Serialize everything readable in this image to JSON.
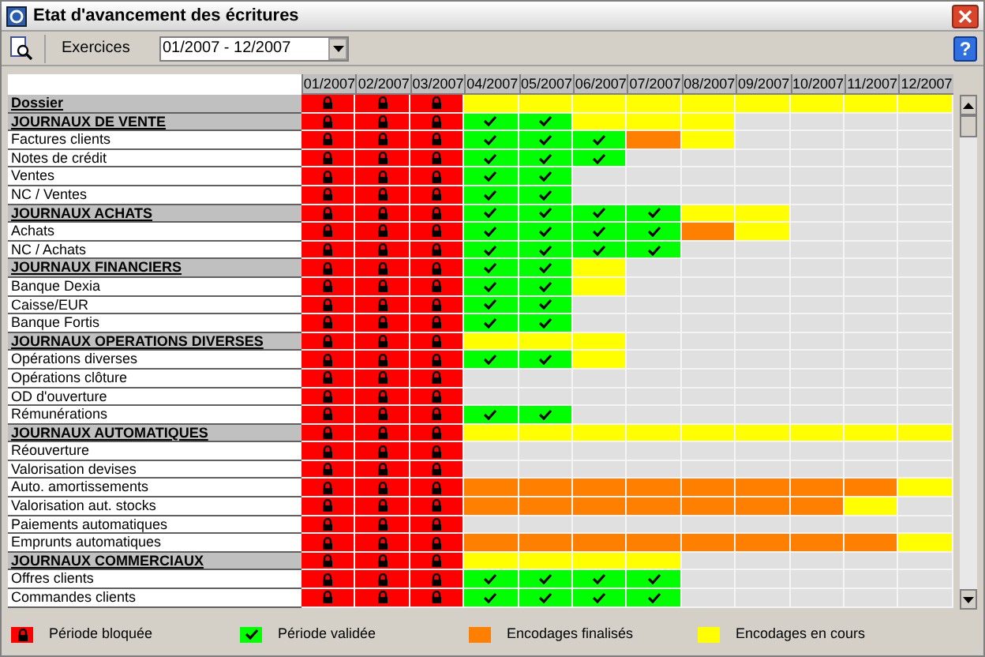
{
  "window": {
    "title": "Etat d'avancement des écritures",
    "help": "?"
  },
  "toolbar": {
    "label": "Exercices",
    "period": "01/2007 - 12/2007"
  },
  "months": [
    "01/2007",
    "02/2007",
    "03/2007",
    "04/2007",
    "05/2007",
    "06/2007",
    "07/2007",
    "08/2007",
    "09/2007",
    "10/2007",
    "11/2007",
    "12/2007"
  ],
  "rows": [
    {
      "label": "Dossier",
      "kind": "group",
      "cells": [
        {
          "kind": "lock"
        },
        {
          "kind": "lock"
        },
        {
          "kind": "lock"
        },
        {
          "kind": "open"
        },
        {
          "kind": "open"
        },
        {
          "kind": "open"
        },
        {
          "kind": "open"
        },
        {
          "kind": "open"
        },
        {
          "kind": "open"
        },
        {
          "kind": "open"
        },
        {
          "kind": "open"
        },
        {
          "kind": "open"
        }
      ]
    },
    {
      "label": "JOURNAUX DE VENTE",
      "kind": "group",
      "cells": [
        {
          "kind": "lock"
        },
        {
          "kind": "lock"
        },
        {
          "kind": "lock"
        },
        {
          "kind": "ok"
        },
        {
          "kind": "ok"
        },
        {
          "kind": "open"
        },
        {
          "kind": "open"
        },
        {
          "kind": "open"
        },
        {
          "kind": "none"
        },
        {
          "kind": "none"
        },
        {
          "kind": "none"
        },
        {
          "kind": "none"
        }
      ]
    },
    {
      "label": "Factures clients",
      "kind": "item",
      "cells": [
        {
          "kind": "lock"
        },
        {
          "kind": "lock"
        },
        {
          "kind": "lock"
        },
        {
          "kind": "ok"
        },
        {
          "kind": "ok"
        },
        {
          "kind": "ok"
        },
        {
          "kind": "done"
        },
        {
          "kind": "open"
        },
        {
          "kind": "none"
        },
        {
          "kind": "none"
        },
        {
          "kind": "none"
        },
        {
          "kind": "none"
        }
      ]
    },
    {
      "label": "Notes de crédit",
      "kind": "item",
      "cells": [
        {
          "kind": "lock"
        },
        {
          "kind": "lock"
        },
        {
          "kind": "lock"
        },
        {
          "kind": "ok"
        },
        {
          "kind": "ok"
        },
        {
          "kind": "ok"
        },
        {
          "kind": "none"
        },
        {
          "kind": "none"
        },
        {
          "kind": "none"
        },
        {
          "kind": "none"
        },
        {
          "kind": "none"
        },
        {
          "kind": "none"
        }
      ]
    },
    {
      "label": "Ventes",
      "kind": "item",
      "cells": [
        {
          "kind": "lock"
        },
        {
          "kind": "lock"
        },
        {
          "kind": "lock"
        },
        {
          "kind": "ok"
        },
        {
          "kind": "ok"
        },
        {
          "kind": "none"
        },
        {
          "kind": "none"
        },
        {
          "kind": "none"
        },
        {
          "kind": "none"
        },
        {
          "kind": "none"
        },
        {
          "kind": "none"
        },
        {
          "kind": "none"
        }
      ]
    },
    {
      "label": "NC / Ventes",
      "kind": "item",
      "cells": [
        {
          "kind": "lock"
        },
        {
          "kind": "lock"
        },
        {
          "kind": "lock"
        },
        {
          "kind": "ok"
        },
        {
          "kind": "ok"
        },
        {
          "kind": "none"
        },
        {
          "kind": "none"
        },
        {
          "kind": "none"
        },
        {
          "kind": "none"
        },
        {
          "kind": "none"
        },
        {
          "kind": "none"
        },
        {
          "kind": "none"
        }
      ]
    },
    {
      "label": "JOURNAUX ACHATS",
      "kind": "group",
      "cells": [
        {
          "kind": "lock"
        },
        {
          "kind": "lock"
        },
        {
          "kind": "lock"
        },
        {
          "kind": "ok"
        },
        {
          "kind": "ok"
        },
        {
          "kind": "ok"
        },
        {
          "kind": "ok"
        },
        {
          "kind": "open"
        },
        {
          "kind": "open"
        },
        {
          "kind": "none"
        },
        {
          "kind": "none"
        },
        {
          "kind": "none"
        }
      ]
    },
    {
      "label": "Achats",
      "kind": "item",
      "cells": [
        {
          "kind": "lock"
        },
        {
          "kind": "lock"
        },
        {
          "kind": "lock"
        },
        {
          "kind": "ok"
        },
        {
          "kind": "ok"
        },
        {
          "kind": "ok"
        },
        {
          "kind": "ok"
        },
        {
          "kind": "done"
        },
        {
          "kind": "open"
        },
        {
          "kind": "none"
        },
        {
          "kind": "none"
        },
        {
          "kind": "none"
        }
      ]
    },
    {
      "label": "NC / Achats",
      "kind": "item",
      "cells": [
        {
          "kind": "lock"
        },
        {
          "kind": "lock"
        },
        {
          "kind": "lock"
        },
        {
          "kind": "ok"
        },
        {
          "kind": "ok"
        },
        {
          "kind": "ok"
        },
        {
          "kind": "ok"
        },
        {
          "kind": "none"
        },
        {
          "kind": "none"
        },
        {
          "kind": "none"
        },
        {
          "kind": "none"
        },
        {
          "kind": "none"
        }
      ]
    },
    {
      "label": "JOURNAUX FINANCIERS",
      "kind": "group",
      "cells": [
        {
          "kind": "lock"
        },
        {
          "kind": "lock"
        },
        {
          "kind": "lock"
        },
        {
          "kind": "ok"
        },
        {
          "kind": "ok"
        },
        {
          "kind": "open"
        },
        {
          "kind": "none"
        },
        {
          "kind": "none"
        },
        {
          "kind": "none"
        },
        {
          "kind": "none"
        },
        {
          "kind": "none"
        },
        {
          "kind": "none"
        }
      ]
    },
    {
      "label": "Banque Dexia",
      "kind": "item",
      "cells": [
        {
          "kind": "lock"
        },
        {
          "kind": "lock"
        },
        {
          "kind": "lock"
        },
        {
          "kind": "ok"
        },
        {
          "kind": "ok"
        },
        {
          "kind": "open"
        },
        {
          "kind": "none"
        },
        {
          "kind": "none"
        },
        {
          "kind": "none"
        },
        {
          "kind": "none"
        },
        {
          "kind": "none"
        },
        {
          "kind": "none"
        }
      ]
    },
    {
      "label": "Caisse/EUR",
      "kind": "item",
      "cells": [
        {
          "kind": "lock"
        },
        {
          "kind": "lock"
        },
        {
          "kind": "lock"
        },
        {
          "kind": "ok"
        },
        {
          "kind": "ok"
        },
        {
          "kind": "none"
        },
        {
          "kind": "none"
        },
        {
          "kind": "none"
        },
        {
          "kind": "none"
        },
        {
          "kind": "none"
        },
        {
          "kind": "none"
        },
        {
          "kind": "none"
        }
      ]
    },
    {
      "label": "Banque Fortis",
      "kind": "item",
      "cells": [
        {
          "kind": "lock"
        },
        {
          "kind": "lock"
        },
        {
          "kind": "lock"
        },
        {
          "kind": "ok"
        },
        {
          "kind": "ok"
        },
        {
          "kind": "none"
        },
        {
          "kind": "none"
        },
        {
          "kind": "none"
        },
        {
          "kind": "none"
        },
        {
          "kind": "none"
        },
        {
          "kind": "none"
        },
        {
          "kind": "none"
        }
      ]
    },
    {
      "label": "JOURNAUX OPERATIONS DIVERSES",
      "kind": "group",
      "cells": [
        {
          "kind": "lock"
        },
        {
          "kind": "lock"
        },
        {
          "kind": "lock"
        },
        {
          "kind": "open"
        },
        {
          "kind": "open"
        },
        {
          "kind": "open"
        },
        {
          "kind": "none"
        },
        {
          "kind": "none"
        },
        {
          "kind": "none"
        },
        {
          "kind": "none"
        },
        {
          "kind": "none"
        },
        {
          "kind": "none"
        }
      ]
    },
    {
      "label": "Opérations diverses",
      "kind": "item",
      "cells": [
        {
          "kind": "lock"
        },
        {
          "kind": "lock"
        },
        {
          "kind": "lock"
        },
        {
          "kind": "ok"
        },
        {
          "kind": "ok"
        },
        {
          "kind": "open"
        },
        {
          "kind": "none"
        },
        {
          "kind": "none"
        },
        {
          "kind": "none"
        },
        {
          "kind": "none"
        },
        {
          "kind": "none"
        },
        {
          "kind": "none"
        }
      ]
    },
    {
      "label": "Opérations clôture",
      "kind": "item",
      "cells": [
        {
          "kind": "lock"
        },
        {
          "kind": "lock"
        },
        {
          "kind": "lock"
        },
        {
          "kind": "none"
        },
        {
          "kind": "none"
        },
        {
          "kind": "none"
        },
        {
          "kind": "none"
        },
        {
          "kind": "none"
        },
        {
          "kind": "none"
        },
        {
          "kind": "none"
        },
        {
          "kind": "none"
        },
        {
          "kind": "none"
        }
      ]
    },
    {
      "label": "OD d'ouverture",
      "kind": "item",
      "cells": [
        {
          "kind": "lock"
        },
        {
          "kind": "lock"
        },
        {
          "kind": "lock"
        },
        {
          "kind": "none"
        },
        {
          "kind": "none"
        },
        {
          "kind": "none"
        },
        {
          "kind": "none"
        },
        {
          "kind": "none"
        },
        {
          "kind": "none"
        },
        {
          "kind": "none"
        },
        {
          "kind": "none"
        },
        {
          "kind": "none"
        }
      ]
    },
    {
      "label": "Rémunérations",
      "kind": "item",
      "cells": [
        {
          "kind": "lock"
        },
        {
          "kind": "lock"
        },
        {
          "kind": "lock"
        },
        {
          "kind": "ok"
        },
        {
          "kind": "ok"
        },
        {
          "kind": "none"
        },
        {
          "kind": "none"
        },
        {
          "kind": "none"
        },
        {
          "kind": "none"
        },
        {
          "kind": "none"
        },
        {
          "kind": "none"
        },
        {
          "kind": "none"
        }
      ]
    },
    {
      "label": "JOURNAUX AUTOMATIQUES",
      "kind": "group",
      "cells": [
        {
          "kind": "lock"
        },
        {
          "kind": "lock"
        },
        {
          "kind": "lock"
        },
        {
          "kind": "open"
        },
        {
          "kind": "open"
        },
        {
          "kind": "open"
        },
        {
          "kind": "open"
        },
        {
          "kind": "open"
        },
        {
          "kind": "open"
        },
        {
          "kind": "open"
        },
        {
          "kind": "open"
        },
        {
          "kind": "open"
        }
      ]
    },
    {
      "label": "Réouverture",
      "kind": "item",
      "cells": [
        {
          "kind": "lock"
        },
        {
          "kind": "lock"
        },
        {
          "kind": "lock"
        },
        {
          "kind": "none"
        },
        {
          "kind": "none"
        },
        {
          "kind": "none"
        },
        {
          "kind": "none"
        },
        {
          "kind": "none"
        },
        {
          "kind": "none"
        },
        {
          "kind": "none"
        },
        {
          "kind": "none"
        },
        {
          "kind": "none"
        }
      ]
    },
    {
      "label": "Valorisation devises",
      "kind": "item",
      "cells": [
        {
          "kind": "lock"
        },
        {
          "kind": "lock"
        },
        {
          "kind": "lock"
        },
        {
          "kind": "none"
        },
        {
          "kind": "none"
        },
        {
          "kind": "none"
        },
        {
          "kind": "none"
        },
        {
          "kind": "none"
        },
        {
          "kind": "none"
        },
        {
          "kind": "none"
        },
        {
          "kind": "none"
        },
        {
          "kind": "none"
        }
      ]
    },
    {
      "label": "Auto. amortissements",
      "kind": "item",
      "cells": [
        {
          "kind": "lock"
        },
        {
          "kind": "lock"
        },
        {
          "kind": "lock"
        },
        {
          "kind": "done"
        },
        {
          "kind": "done"
        },
        {
          "kind": "done"
        },
        {
          "kind": "done"
        },
        {
          "kind": "done"
        },
        {
          "kind": "done"
        },
        {
          "kind": "done"
        },
        {
          "kind": "done"
        },
        {
          "kind": "open"
        }
      ]
    },
    {
      "label": "Valorisation aut. stocks",
      "kind": "item",
      "cells": [
        {
          "kind": "lock"
        },
        {
          "kind": "lock"
        },
        {
          "kind": "lock"
        },
        {
          "kind": "done"
        },
        {
          "kind": "done"
        },
        {
          "kind": "done"
        },
        {
          "kind": "done"
        },
        {
          "kind": "done"
        },
        {
          "kind": "done"
        },
        {
          "kind": "done"
        },
        {
          "kind": "open"
        },
        {
          "kind": "none"
        }
      ]
    },
    {
      "label": "Paiements automatiques",
      "kind": "item",
      "cells": [
        {
          "kind": "lock"
        },
        {
          "kind": "lock"
        },
        {
          "kind": "lock"
        },
        {
          "kind": "none"
        },
        {
          "kind": "none"
        },
        {
          "kind": "none"
        },
        {
          "kind": "none"
        },
        {
          "kind": "none"
        },
        {
          "kind": "none"
        },
        {
          "kind": "none"
        },
        {
          "kind": "none"
        },
        {
          "kind": "none"
        }
      ]
    },
    {
      "label": "Emprunts automatiques",
      "kind": "item",
      "cells": [
        {
          "kind": "lock"
        },
        {
          "kind": "lock"
        },
        {
          "kind": "lock"
        },
        {
          "kind": "done"
        },
        {
          "kind": "done"
        },
        {
          "kind": "done"
        },
        {
          "kind": "done"
        },
        {
          "kind": "done"
        },
        {
          "kind": "done"
        },
        {
          "kind": "done"
        },
        {
          "kind": "done"
        },
        {
          "kind": "open"
        }
      ]
    },
    {
      "label": "JOURNAUX COMMERCIAUX",
      "kind": "group",
      "cells": [
        {
          "kind": "lock"
        },
        {
          "kind": "lock"
        },
        {
          "kind": "lock"
        },
        {
          "kind": "open"
        },
        {
          "kind": "open"
        },
        {
          "kind": "open"
        },
        {
          "kind": "open"
        },
        {
          "kind": "none"
        },
        {
          "kind": "none"
        },
        {
          "kind": "none"
        },
        {
          "kind": "none"
        },
        {
          "kind": "none"
        }
      ]
    },
    {
      "label": "Offres clients",
      "kind": "item",
      "cells": [
        {
          "kind": "lock"
        },
        {
          "kind": "lock"
        },
        {
          "kind": "lock"
        },
        {
          "kind": "ok"
        },
        {
          "kind": "ok"
        },
        {
          "kind": "ok"
        },
        {
          "kind": "ok"
        },
        {
          "kind": "none"
        },
        {
          "kind": "none"
        },
        {
          "kind": "none"
        },
        {
          "kind": "none"
        },
        {
          "kind": "none"
        }
      ]
    },
    {
      "label": "Commandes clients",
      "kind": "item",
      "cells": [
        {
          "kind": "lock"
        },
        {
          "kind": "lock"
        },
        {
          "kind": "lock"
        },
        {
          "kind": "ok"
        },
        {
          "kind": "ok"
        },
        {
          "kind": "ok"
        },
        {
          "kind": "ok"
        },
        {
          "kind": "none"
        },
        {
          "kind": "none"
        },
        {
          "kind": "none"
        },
        {
          "kind": "none"
        },
        {
          "kind": "none"
        }
      ]
    }
  ],
  "legend": [
    {
      "kind": "lock",
      "label": "Période bloquée"
    },
    {
      "kind": "ok",
      "label": "Période validée"
    },
    {
      "kind": "done",
      "label": "Encodages finalisés"
    },
    {
      "kind": "open",
      "label": "Encodages en cours"
    }
  ]
}
